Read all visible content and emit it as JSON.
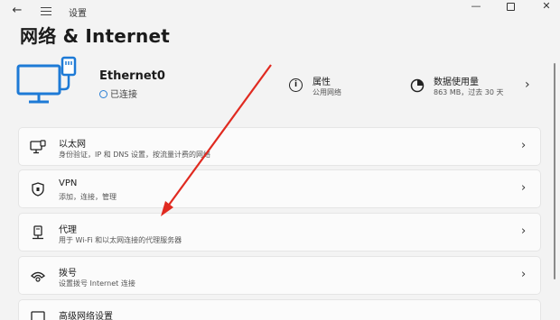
{
  "window": {
    "title": "设置",
    "minimize": "—",
    "close": "✕"
  },
  "page": {
    "title": "网络 & Internet"
  },
  "ethernet": {
    "name": "Ethernet0",
    "status": "已连接"
  },
  "properties": {
    "title": "属性",
    "subtitle": "公用网络"
  },
  "data_usage": {
    "title": "数据使用量",
    "subtitle": "863 MB，过去 30 天"
  },
  "cards": [
    {
      "title": "以太网",
      "subtitle": "身份验证，IP 和 DNS 设置，按流量计费的网络",
      "icon": "monitor-network-icon"
    },
    {
      "title": "VPN",
      "subtitle": "添加，连接，管理",
      "icon": "shield-icon"
    },
    {
      "title": "代理",
      "subtitle": "用于 Wi-Fi 和以太网连接的代理服务器",
      "icon": "proxy-server-icon"
    },
    {
      "title": "拨号",
      "subtitle": "设置拨号 Internet 连接",
      "icon": "dialup-phone-icon"
    },
    {
      "title": "高级网络设置",
      "subtitle": "",
      "icon": "monitor-icon"
    }
  ],
  "chevron": "›",
  "colors": {
    "accent": "#1d7ad6",
    "annotation_arrow": "#e02a20"
  }
}
